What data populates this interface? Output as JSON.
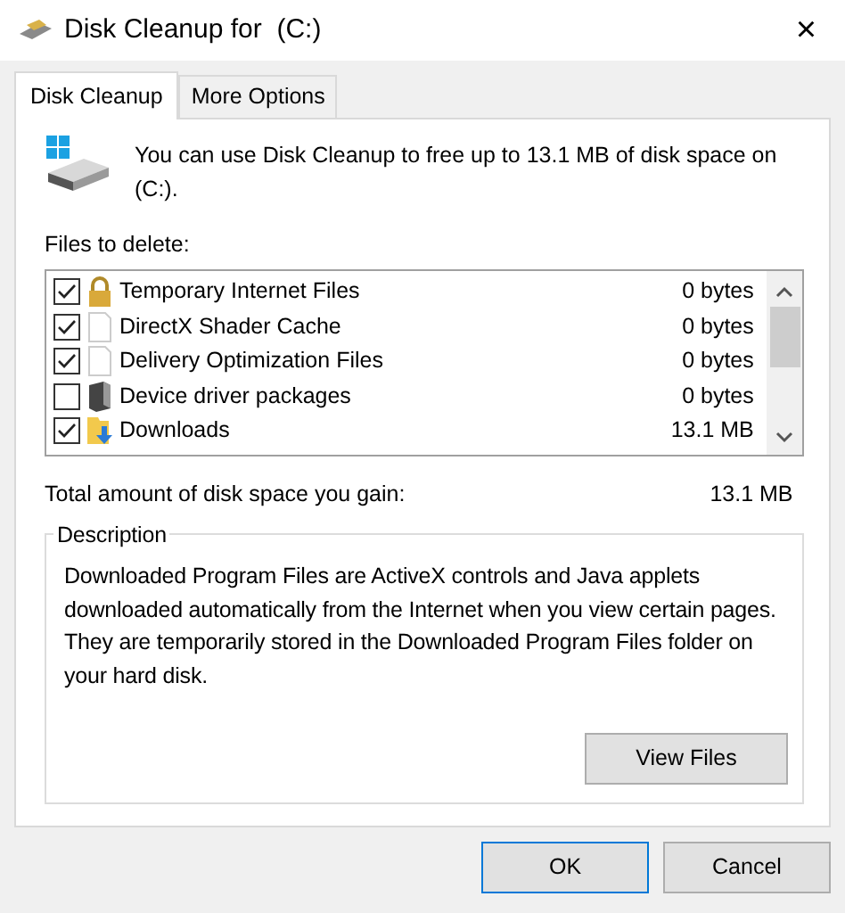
{
  "window": {
    "title": "Disk Cleanup for  (C:)",
    "close": "×"
  },
  "tabs": [
    {
      "label": "Disk Cleanup",
      "selected": true
    },
    {
      "label": "More Options",
      "selected": false
    }
  ],
  "intro": "You can use Disk Cleanup to free up to 13.1 MB of disk space on  (C:).",
  "files_label": "Files to delete:",
  "files": [
    {
      "name": "Temporary Internet Files",
      "size": "0 bytes",
      "checked": true,
      "kind": "lock"
    },
    {
      "name": "DirectX Shader Cache",
      "size": "0 bytes",
      "checked": true,
      "kind": "file"
    },
    {
      "name": "Delivery Optimization Files",
      "size": "0 bytes",
      "checked": true,
      "kind": "file"
    },
    {
      "name": "Device driver packages",
      "size": "0 bytes",
      "checked": false,
      "kind": "driver"
    },
    {
      "name": "Downloads",
      "size": "13.1 MB",
      "checked": true,
      "kind": "download"
    }
  ],
  "total": {
    "label": "Total amount of disk space you gain:",
    "value": "13.1 MB"
  },
  "description": {
    "title": "Description",
    "text": "Downloaded Program Files are ActiveX controls and Java applets downloaded automatically from the Internet when you view certain pages. They are temporarily stored in the Downloaded Program Files folder on your hard disk.",
    "button": "View Files"
  },
  "buttons": [
    {
      "label": "OK",
      "kind": "default"
    },
    {
      "label": "Cancel",
      "kind": "normal"
    }
  ]
}
